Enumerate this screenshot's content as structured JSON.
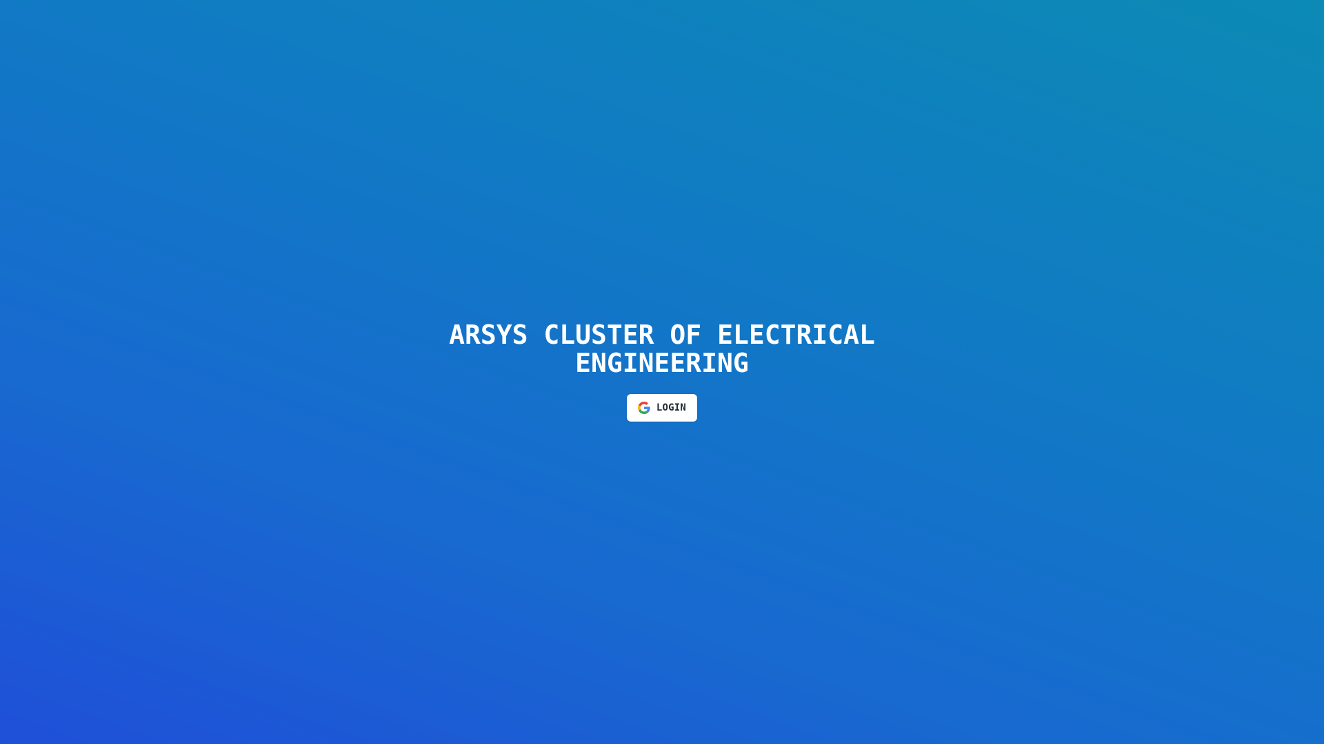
{
  "page": {
    "title": "ARSYS CLUSTER OF ELECTRICAL ENGINEERING"
  },
  "login": {
    "label": "LOGIN",
    "icon": "google-icon"
  },
  "colors": {
    "background_top_right": "#0c8ab5",
    "background_bottom_left": "#1f4fd8",
    "title_text": "#ffffff",
    "button_background": "#ffffff",
    "button_text": "#1f2937"
  }
}
